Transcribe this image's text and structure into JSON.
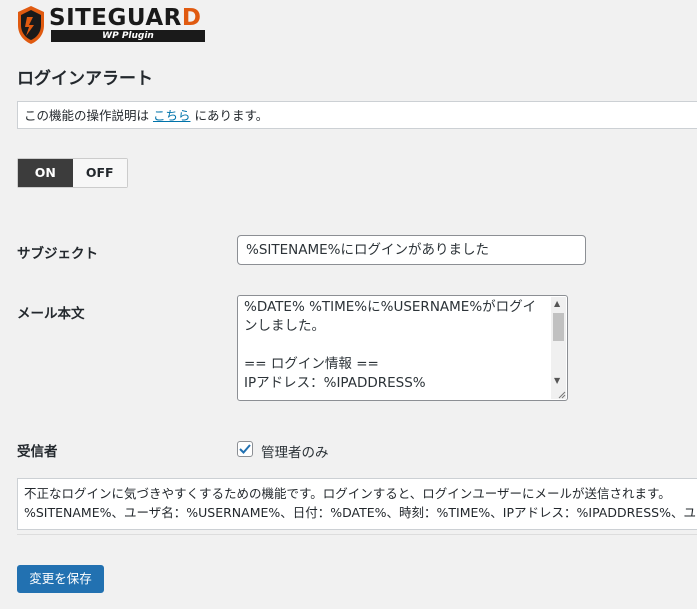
{
  "logo": {
    "name_main": "SITEGUAR",
    "name_last": "D",
    "sub": "WP Plugin",
    "shield_color": "#e05a10"
  },
  "page_title": "ログインアラート",
  "notice": {
    "before": "この機能の操作説明は ",
    "link": "こちら",
    "after": " にあります。"
  },
  "toggle": {
    "on_label": "ON",
    "off_label": "OFF",
    "selected": "ON"
  },
  "subject": {
    "label": "サブジェクト",
    "value": "%SITENAME%にログインがありました"
  },
  "body": {
    "label": "メール本文",
    "value": "%DATE% %TIME%に%USERNAME%がログインしました。\n\n== ログイン情報 ==\nIPアドレス：%IPADDRESS%"
  },
  "recipient": {
    "label": "受信者",
    "checkbox_label": "管理者のみ",
    "checked": true
  },
  "description": {
    "line1": "不正なログインに気づきやすくするための機能です。ログインすると、ログインユーザーにメールが送信されます。",
    "line2": "%SITENAME%、ユーザ名：%USERNAME%、日付：%DATE%、時刻：%TIME%、IPアドレス：%IPADDRESS%、ユーザ"
  },
  "save_label": "変更を保存",
  "colors": {
    "accent": "#2271b1",
    "link": "#0073aa",
    "toggle_on": "#3c3c3c"
  }
}
